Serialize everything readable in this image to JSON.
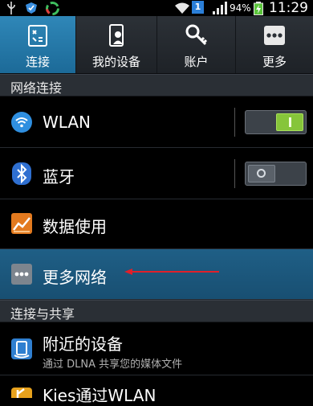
{
  "status_bar": {
    "time": "11:29",
    "battery_percent": "94%",
    "notification_badge": "1",
    "icons": [
      "usb-icon",
      "shield-icon",
      "sync-icon",
      "wifi-icon",
      "sim-badge",
      "signal-icon",
      "battery-charging-icon"
    ]
  },
  "tabs": [
    {
      "label": "连接",
      "icon": "connections-icon",
      "active": true
    },
    {
      "label": "我的设备",
      "icon": "my-device-icon",
      "active": false
    },
    {
      "label": "账户",
      "icon": "accounts-key-icon",
      "active": false
    },
    {
      "label": "更多",
      "icon": "more-dots-icon",
      "active": false
    }
  ],
  "sections": {
    "network": "网络连接",
    "connect_share": "连接与共享"
  },
  "rows": {
    "wlan": {
      "label": "WLAN",
      "toggle": "on"
    },
    "bluetooth": {
      "label": "蓝牙",
      "toggle": "off"
    },
    "data_usage": {
      "label": "数据使用"
    },
    "more_networks": {
      "label": "更多网络",
      "highlighted": true
    },
    "nearby_devices": {
      "label": "附近的设备",
      "subtitle": "通过 DLNA 共享您的媒体文件"
    },
    "kies_wlan": {
      "label": "Kies通过WLAN"
    }
  },
  "colors": {
    "active_tab": "#2f87b8",
    "highlight_row": "#1f5f86",
    "toggle_on": "#86c53a",
    "annotation_arrow": "#e0202a"
  }
}
